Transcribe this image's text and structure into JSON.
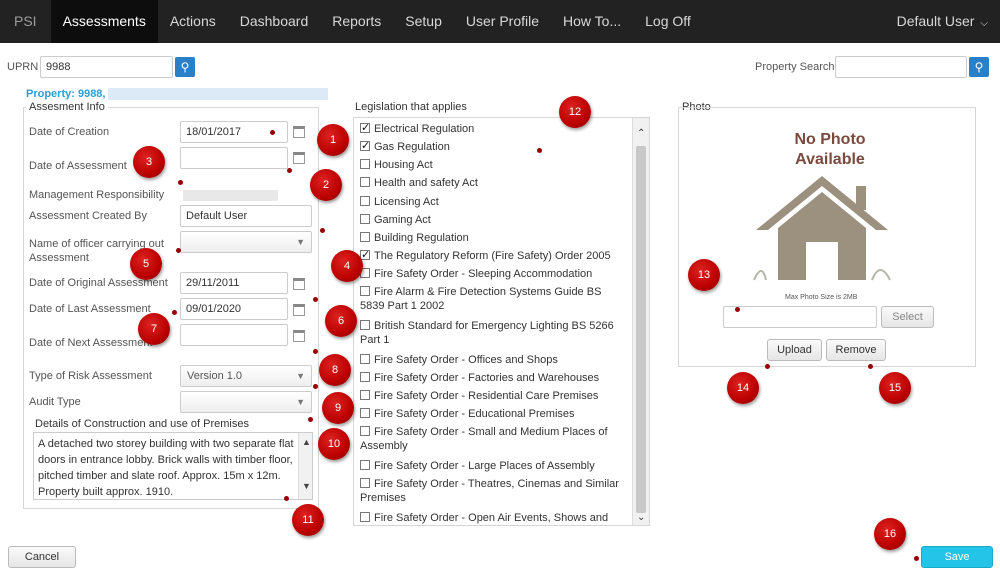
{
  "nav": {
    "brand": "PSI",
    "items": [
      "Assessments",
      "Actions",
      "Dashboard",
      "Reports",
      "Setup",
      "User Profile",
      "How To...",
      "Log Off"
    ],
    "user": "Default User"
  },
  "uprn": {
    "label": "UPRN",
    "value": "9988"
  },
  "property_search": {
    "label": "Property Search",
    "value": ""
  },
  "property_heading": "Property: 9988,",
  "info": {
    "title": "Assesment Info",
    "date_of_creation_label": "Date of Creation",
    "date_of_creation": "18/01/2017",
    "date_of_assessment_label": "Date of Assessment",
    "date_of_assessment": "",
    "management_label": "Management Responsibility",
    "created_by_label": "Assessment Created By",
    "created_by": "Default User",
    "officer_label": "Name of officer carrying out Assessment",
    "officer_value": "",
    "original_label": "Date of Original Assessment",
    "original": "29/11/2011",
    "last_label": "Date of Last Assessment",
    "last": "09/01/2020",
    "next_label": "Date of Next Assessment",
    "next": "",
    "risk_type_label": "Type of Risk Assessment",
    "risk_type": "Version 1.0",
    "audit_label": "Audit Type",
    "audit": "",
    "details_title": "Details of Construction and use of Premises",
    "details_text": "A detached two storey building with two separate flat doors in entrance lobby. Brick walls with timber floor, pitched timber and slate roof. Approx. 15m x 12m. Property built approx. 1910."
  },
  "legislation": {
    "title": "Legislation that applies",
    "items": [
      {
        "label": "Electrical Regulation",
        "checked": true
      },
      {
        "label": "Gas Regulation",
        "checked": true
      },
      {
        "label": "Housing Act",
        "checked": false
      },
      {
        "label": "Health and safety Act",
        "checked": false
      },
      {
        "label": "Licensing Act",
        "checked": false
      },
      {
        "label": "Gaming Act",
        "checked": false
      },
      {
        "label": "Building Regulation",
        "checked": false
      },
      {
        "label": "The Regulatory Reform (Fire Safety) Order 2005",
        "checked": true
      },
      {
        "label": "Fire Safety Order - Sleeping Accommodation",
        "checked": false
      },
      {
        "label": "Fire Alarm & Fire Detection Systems Guide BS 5839 Part 1 2002",
        "checked": false
      },
      {
        "label": "British Standard for Emergency Lighting BS 5266 Part 1",
        "checked": false
      },
      {
        "label": "Fire Safety Order - Offices and Shops",
        "checked": false
      },
      {
        "label": "Fire Safety Order - Factories and Warehouses",
        "checked": false
      },
      {
        "label": "Fire Safety Order - Residential Care Premises",
        "checked": false
      },
      {
        "label": "Fire Safety Order - Educational Premises",
        "checked": false
      },
      {
        "label": "Fire Safety Order - Small and Medium Places of Assembly",
        "checked": false
      },
      {
        "label": "Fire Safety Order - Large Places of Assembly",
        "checked": false
      },
      {
        "label": "Fire Safety Order - Theatres, Cinemas and Similar Premises",
        "checked": false
      },
      {
        "label": "Fire Safety Order - Open Air Events, Shows and",
        "checked": false
      }
    ]
  },
  "photo": {
    "title": "Photo",
    "no_photo_line1": "No Photo",
    "no_photo_line2": "Available",
    "max_size": "Max Photo Size is 2MB",
    "select_label": "Select",
    "upload_label": "Upload",
    "remove_label": "Remove"
  },
  "buttons": {
    "cancel": "Cancel",
    "save": "Save"
  },
  "callouts": [
    "1",
    "2",
    "3",
    "4",
    "5",
    "6",
    "7",
    "8",
    "9",
    "10",
    "11",
    "12",
    "13",
    "14",
    "15",
    "16"
  ],
  "colors": {
    "nav_bg": "#222222",
    "accent": "#2a7fc9",
    "save": "#24c4e8",
    "callout": "#b00000",
    "property_link": "#2a9fd6"
  }
}
